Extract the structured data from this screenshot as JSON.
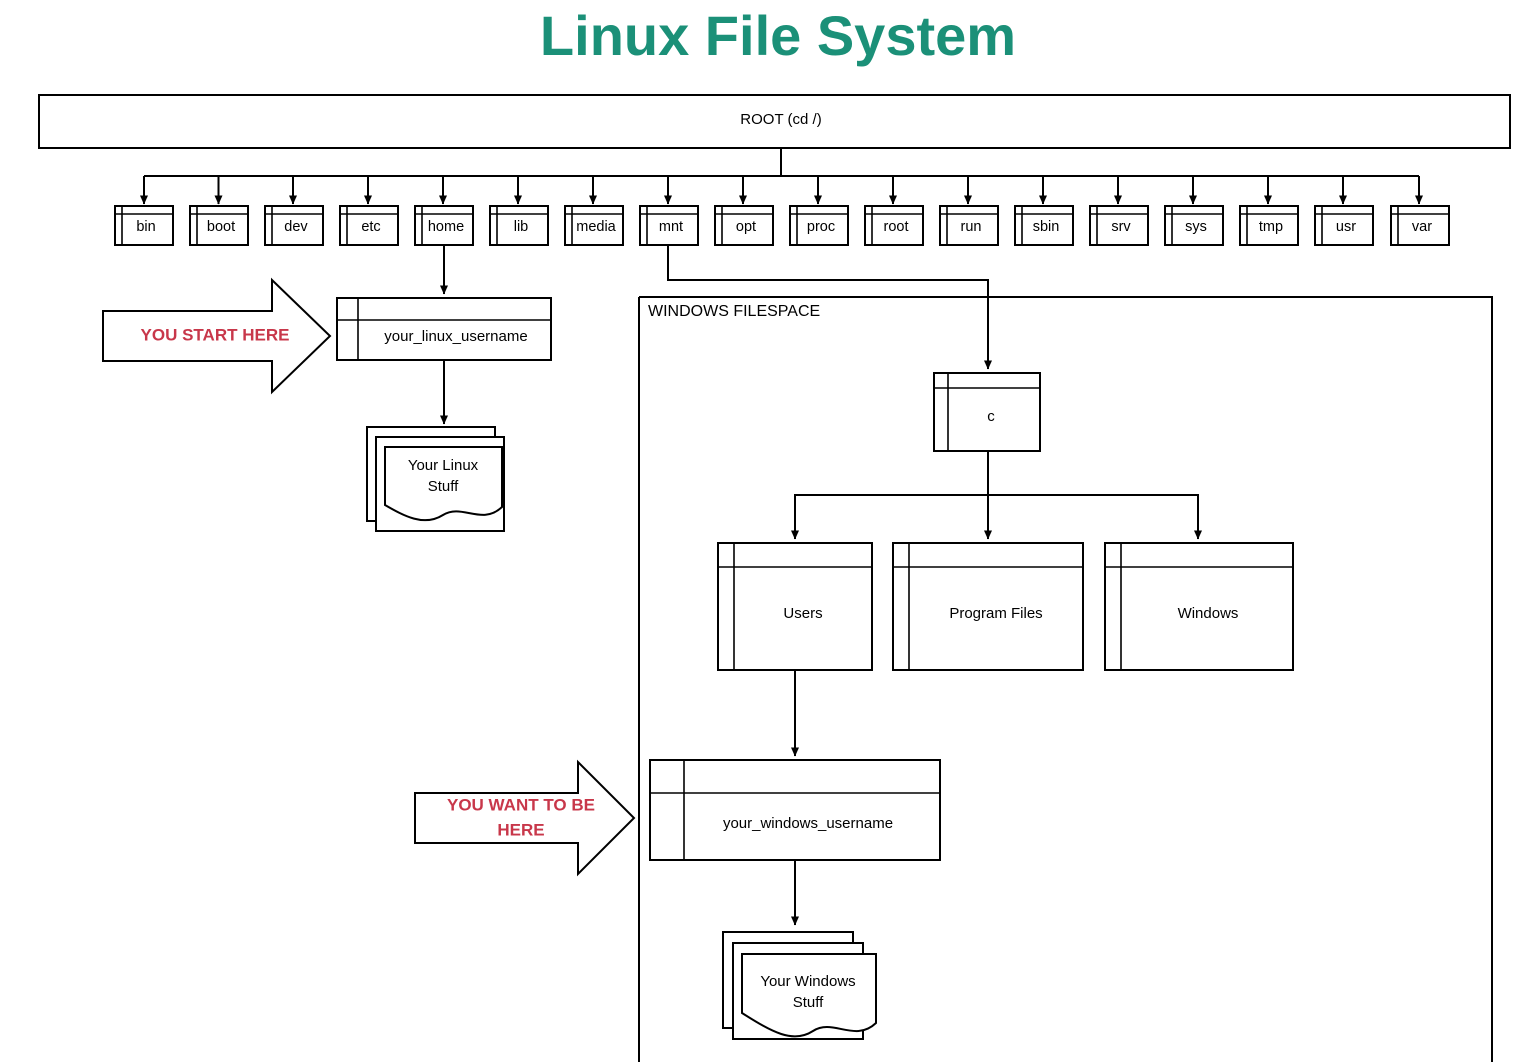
{
  "title": "Linux File System",
  "root": {
    "label": "ROOT  (cd /)"
  },
  "directories": [
    {
      "name": "bin"
    },
    {
      "name": "boot"
    },
    {
      "name": "dev"
    },
    {
      "name": "etc"
    },
    {
      "name": "home"
    },
    {
      "name": "lib"
    },
    {
      "name": "media"
    },
    {
      "name": "mnt"
    },
    {
      "name": "opt"
    },
    {
      "name": "proc"
    },
    {
      "name": "root"
    },
    {
      "name": "run"
    },
    {
      "name": "sbin"
    },
    {
      "name": "srv"
    },
    {
      "name": "sys"
    },
    {
      "name": "tmp"
    },
    {
      "name": "usr"
    },
    {
      "name": "var"
    }
  ],
  "linux_branch": {
    "username_box": "your_linux_username",
    "stuff_line1": "Your Linux",
    "stuff_line2": "Stuff",
    "callout_line1": "YOU START HERE",
    "callout_line2": ""
  },
  "windows_filespace": {
    "container_label": "WINDOWS FILESPACE",
    "drive": "c",
    "folders": [
      {
        "name": "Users"
      },
      {
        "name": "Program Files"
      },
      {
        "name": "Windows"
      }
    ],
    "username_box": "your_windows_username",
    "stuff_line1": "Your Windows",
    "stuff_line2": "Stuff",
    "callout_line1": "YOU WANT TO BE",
    "callout_line2": "HERE"
  },
  "colors": {
    "title": "#1b9078",
    "callout_text": "#c8374a",
    "stroke": "#000000",
    "background": "#ffffff"
  }
}
